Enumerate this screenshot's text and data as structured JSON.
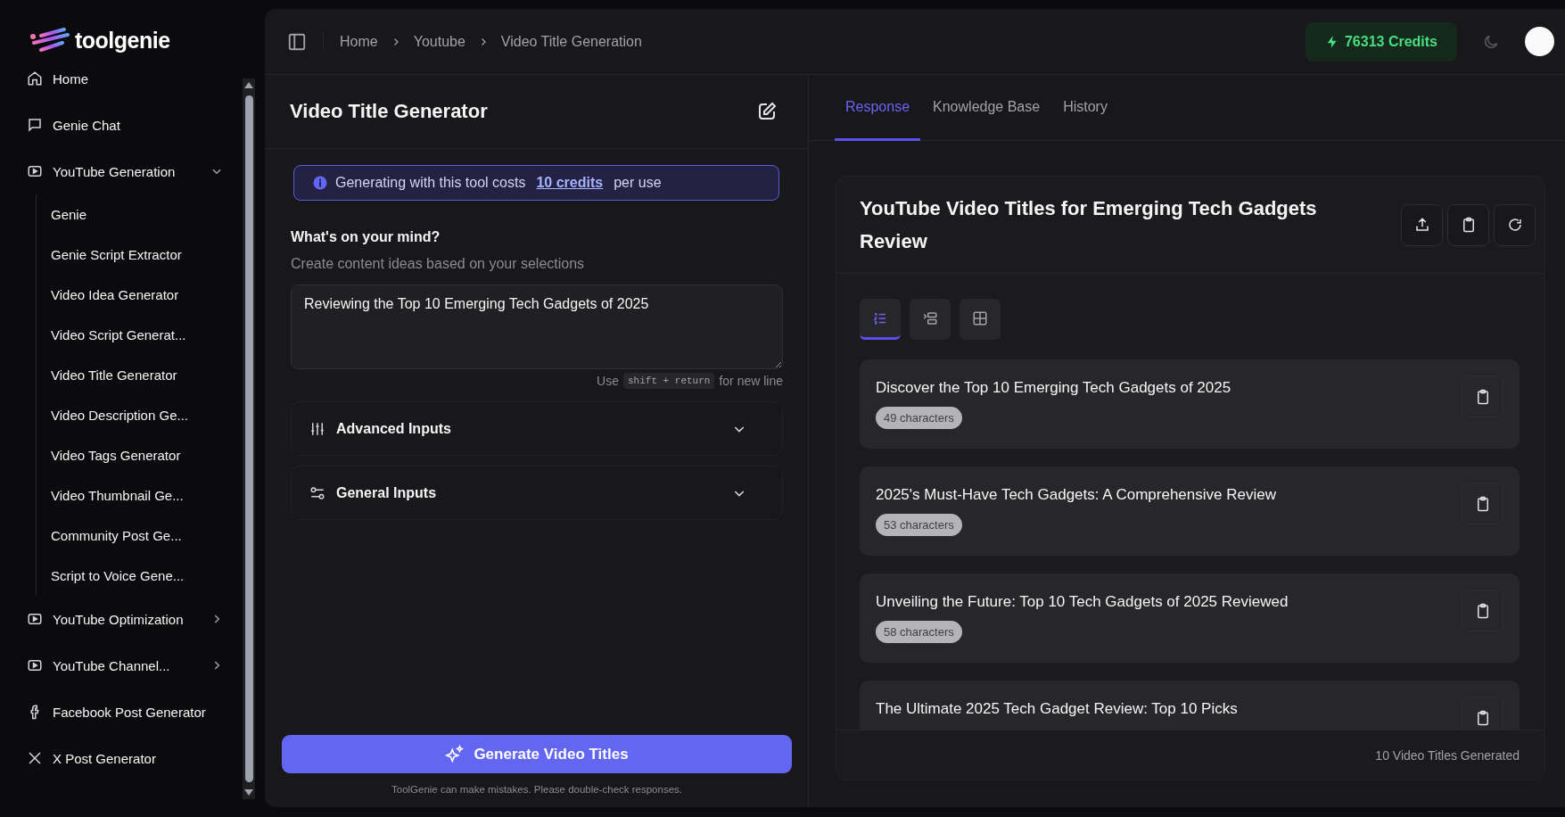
{
  "brand": {
    "name": "toolgenie"
  },
  "sidebar": {
    "items": [
      {
        "label": "Home",
        "kind": "link"
      },
      {
        "label": "Genie Chat",
        "kind": "link"
      },
      {
        "label": "YouTube Generation",
        "kind": "group",
        "expanded": true,
        "children": [
          {
            "label": "Genie"
          },
          {
            "label": "Genie Script Extractor"
          },
          {
            "label": "Video Idea Generator"
          },
          {
            "label": "Video Script Generat..."
          },
          {
            "label": "Video Title Generator"
          },
          {
            "label": "Video Description Ge..."
          },
          {
            "label": "Video Tags Generator"
          },
          {
            "label": "Video Thumbnail Ge..."
          },
          {
            "label": "Community Post Ge..."
          },
          {
            "label": "Script to Voice Gene..."
          }
        ]
      },
      {
        "label": "YouTube Optimization",
        "kind": "group",
        "expanded": false
      },
      {
        "label": "YouTube Channel...",
        "kind": "group",
        "expanded": false
      },
      {
        "label": "Facebook Post Generator",
        "kind": "link"
      },
      {
        "label": "X Post Generator",
        "kind": "link"
      }
    ]
  },
  "header": {
    "breadcrumb": [
      "Home",
      "Youtube",
      "Video Title Generation"
    ],
    "credits": "76313 Credits"
  },
  "tool": {
    "title": "Video Title Generator",
    "notice": {
      "before": "Generating with this tool costs",
      "link": "10 credits",
      "after": "per use"
    },
    "prompt_label": "What's on your mind?",
    "prompt_description": "Create content ideas based on your selections",
    "prompt_value": "Reviewing the Top 10 Emerging Tech Gadgets of 2025",
    "hint": {
      "before": "Use",
      "key": "shift + return",
      "after": "for new line"
    },
    "sections": [
      {
        "label": "Advanced Inputs",
        "expanded": false
      },
      {
        "label": "General Inputs",
        "expanded": false
      }
    ],
    "generate_button": "Generate Video Titles",
    "disclaimer": "ToolGenie can make mistakes. Please double-check responses."
  },
  "tabs": [
    {
      "label": "Response",
      "selected": true
    },
    {
      "label": "Knowledge Base",
      "selected": false
    },
    {
      "label": "History",
      "selected": false
    }
  ],
  "response": {
    "title": "YouTube Video Titles for Emerging Tech Gadgets Review",
    "view_modes": [
      {
        "selected": true
      },
      {
        "selected": false
      },
      {
        "selected": false
      }
    ],
    "results": [
      {
        "title": "Discover the Top 10 Emerging Tech Gadgets of 2025",
        "count": "49 characters"
      },
      {
        "title": "2025's Must-Have Tech Gadgets: A Comprehensive Review",
        "count": "53 characters"
      },
      {
        "title": "Unveiling the Future: Top 10 Tech Gadgets of 2025 Reviewed",
        "count": "58 characters"
      },
      {
        "title": "The Ultimate 2025 Tech Gadget Review: Top 10 Picks"
      }
    ],
    "footer": "10 Video Titles Generated"
  }
}
